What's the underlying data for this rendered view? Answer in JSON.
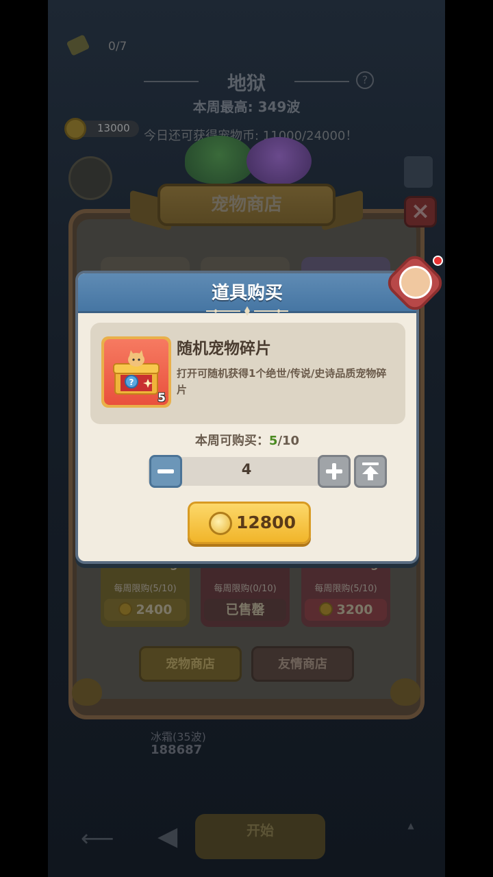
{
  "background": {
    "ticket_count": "0/7",
    "mode_title": "地狱",
    "weekly_record": "本周最高: 349波",
    "coin_balance": "13000",
    "earn_text": "今日还可获得宠物币: 11000/24000！",
    "shop": {
      "title": "宠物商店",
      "cards": [
        {
          "count": "5",
          "limit": "每周限购(5/10)",
          "price": "2400"
        },
        {
          "count": "",
          "limit": "每周限购(0/10)",
          "price": "已售罄"
        },
        {
          "count": "5",
          "limit": "每周限购(5/10)",
          "price": "3200"
        }
      ],
      "tabs": [
        "宠物商店",
        "友情商店"
      ]
    },
    "rank_label": "冰霜(35波)",
    "rank_score": "188687",
    "start_label": "开始"
  },
  "dialog": {
    "title": "道具购买",
    "item": {
      "name": "随机宠物碎片",
      "description": "打开可随机获得1个绝世/传说/史诗品质宠物碎片",
      "count": "5",
      "icon": "mystery-chest-icon"
    },
    "limit_label": "本周可购买：",
    "limit_current": "5",
    "limit_total": "/10",
    "quantity": "4",
    "price": "12800",
    "colors": {
      "header": "#4f7fab",
      "buy_button": "#f5c43e",
      "minus_button": "#6c96b8"
    }
  }
}
